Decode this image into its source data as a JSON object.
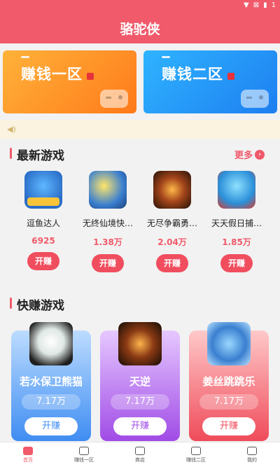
{
  "status_bar": {
    "battery": "1"
  },
  "app": {
    "title": "骆驼侠"
  },
  "banners": [
    {
      "label": "赚钱一区",
      "color": "#ff8a22"
    },
    {
      "label": "赚钱二区",
      "color": "#2592f5"
    }
  ],
  "sections": {
    "new_games": {
      "heading": "最新游戏",
      "more": "更多"
    },
    "quick_games": {
      "heading": "快赚游戏"
    }
  },
  "new_games": [
    {
      "name": "逗鱼达人",
      "count": "6925",
      "button": "开赚",
      "icon": "shark-game-icon"
    },
    {
      "name": "无终仙境快…",
      "count": "1.38万",
      "button": "开赚",
      "icon": "star-game-icon"
    },
    {
      "name": "无尽争霸勇…",
      "count": "2.04万",
      "button": "开赚",
      "icon": "fire-game-icon"
    },
    {
      "name": "天天假日捕…",
      "count": "1.85万",
      "button": "开赚",
      "icon": "fish-game-icon"
    }
  ],
  "quick_games": [
    {
      "name": "若水保卫熊猫",
      "count": "7.17万",
      "button": "开赚",
      "icon": "panda-game-icon"
    },
    {
      "name": "天逆",
      "count": "7.17万",
      "button": "开赚",
      "icon": "tianni-game-icon"
    },
    {
      "name": "姜丝跳跳乐",
      "count": "7.17万",
      "button": "开赚",
      "icon": "jiangsi-game-icon"
    }
  ],
  "tabs": [
    {
      "label": "首页",
      "active": true
    },
    {
      "label": "赚钱一区"
    },
    {
      "label": "商店"
    },
    {
      "label": "赚钱二区"
    },
    {
      "label": "我的"
    }
  ],
  "colors": {
    "accent": "#f05a6a",
    "notice_bg": "#fbf3df"
  }
}
